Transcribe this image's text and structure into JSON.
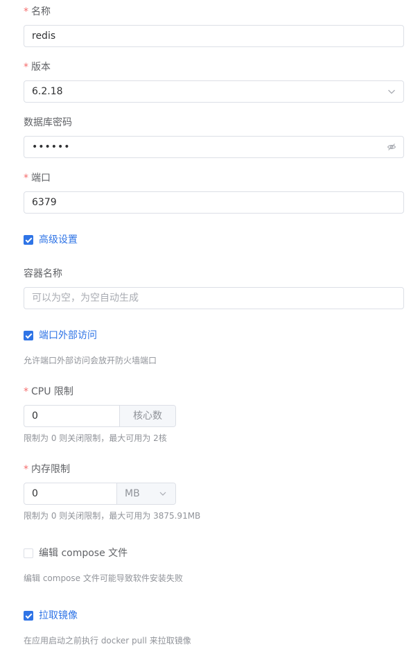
{
  "colors": {
    "primary": "#2f74e6",
    "required": "#f56c6c",
    "border": "#dcdfe6",
    "hint": "#909399"
  },
  "name": {
    "label": "名称",
    "required_mark": "*",
    "value": "redis"
  },
  "version": {
    "label": "版本",
    "required_mark": "*",
    "value": "6.2.18",
    "icon": "chevron-down-icon"
  },
  "db_password": {
    "label": "数据库密码",
    "value": "••••••",
    "icon": "eye-hide-icon"
  },
  "port": {
    "label": "端口",
    "required_mark": "*",
    "value": "6379"
  },
  "advanced": {
    "label": "高级设置",
    "checked": true
  },
  "container_name": {
    "label": "容器名称",
    "placeholder": "可以为空，为空自动生成",
    "value": ""
  },
  "port_external": {
    "label": "端口外部访问",
    "checked": true,
    "hint": "允许端口外部访问会放开防火墙端口"
  },
  "cpu_limit": {
    "label": "CPU 限制",
    "required_mark": "*",
    "value": "0",
    "append": "核心数",
    "hint": "限制为 0 则关闭限制，最大可用为 2核"
  },
  "memory_limit": {
    "label": "内存限制",
    "required_mark": "*",
    "value": "0",
    "unit": "MB",
    "hint": "限制为 0 则关闭限制，最大可用为 3875.91MB"
  },
  "edit_compose": {
    "label": "编辑 compose 文件",
    "checked": false,
    "hint": "编辑 compose 文件可能导致软件安装失败"
  },
  "pull_image": {
    "label": "拉取镜像",
    "checked": true,
    "hint": "在应用启动之前执行 docker pull 来拉取镜像"
  }
}
